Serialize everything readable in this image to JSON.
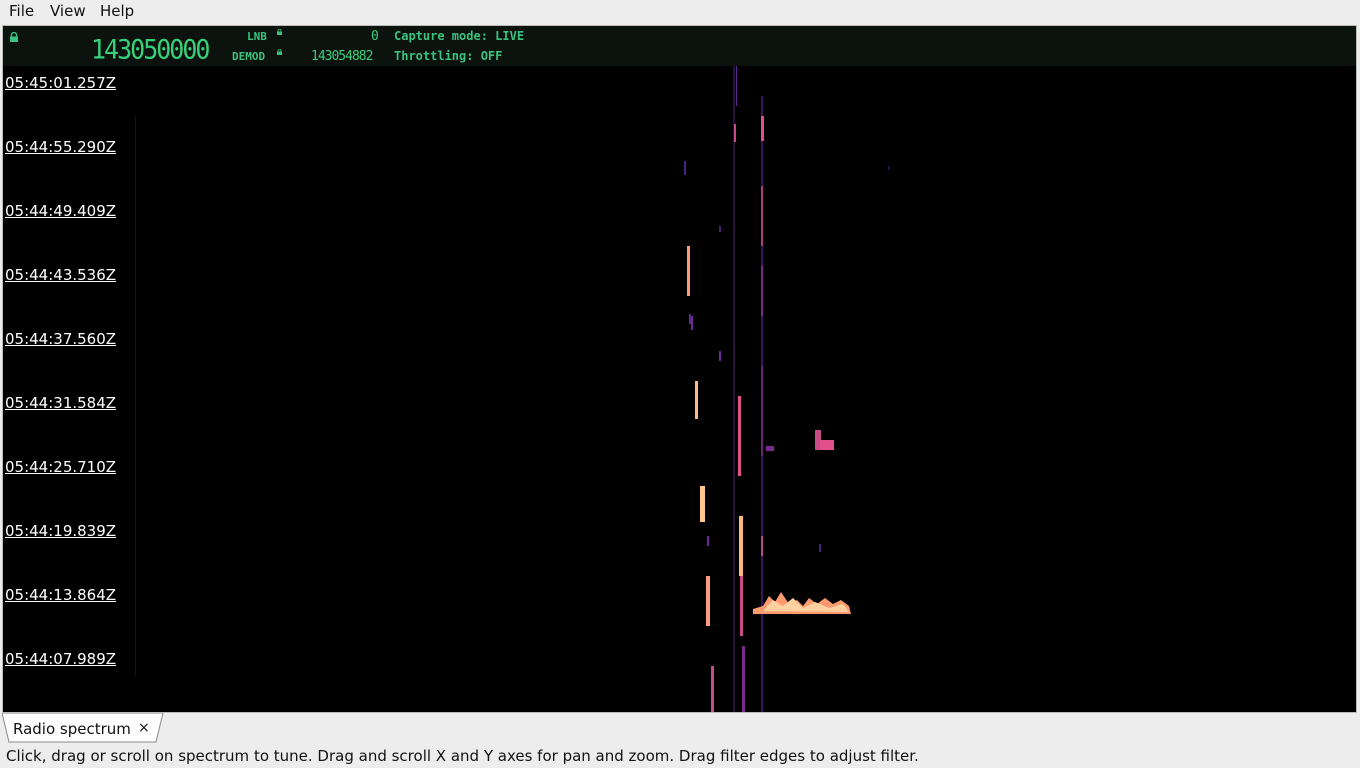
{
  "menu": {
    "file": "File",
    "view": "View",
    "help": "Help"
  },
  "header": {
    "main_frequency": "143050000",
    "lnb_label": "LNB",
    "lnb_value": "0",
    "demod_label": "DEMOD",
    "demod_value": "143054882",
    "capture_mode": "Capture mode: LIVE",
    "throttling": "Throttling: OFF"
  },
  "time_axis": {
    "labels": [
      "05:45:01.257Z",
      "05:44:55.290Z",
      "05:44:49.409Z",
      "05:44:43.536Z",
      "05:44:37.560Z",
      "05:44:31.584Z",
      "05:44:25.710Z",
      "05:44:19.839Z",
      "05:44:13.864Z",
      "05:44:07.989Z"
    ]
  },
  "tabs": [
    {
      "label": "Radio spectrum",
      "close": "×"
    }
  ],
  "status_bar": "Click, drag or scroll on spectrum to tune. Drag and scroll X and Y axes for pan and zoom. Drag filter edges to adjust filter.",
  "colors": {
    "display_green": "#38d07a",
    "waterfall_bg": "#000000",
    "signal_hot": "#ffb882",
    "signal_mid": "#e0508a",
    "signal_low": "#6a2a9a"
  }
}
